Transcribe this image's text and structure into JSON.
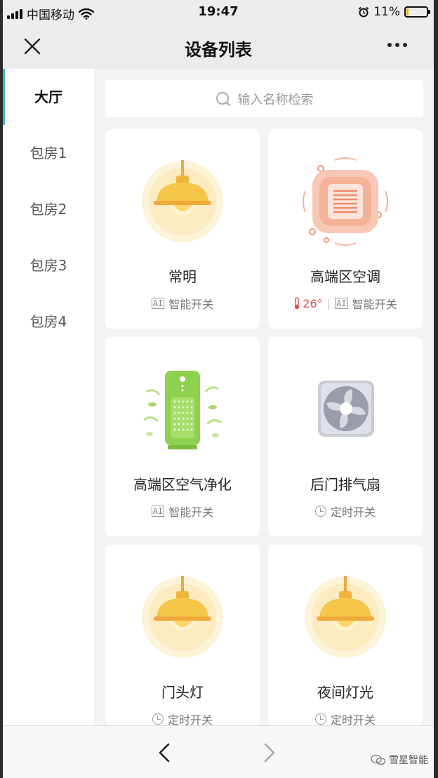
{
  "status_bar": {
    "carrier": "中国移动",
    "time": "19:47",
    "battery_percent": "11%",
    "battery_level": 0.11
  },
  "nav": {
    "title": "设备列表"
  },
  "sidebar": {
    "items": [
      {
        "label": "大厅",
        "active": true
      },
      {
        "label": "包房1",
        "active": false
      },
      {
        "label": "包房2",
        "active": false
      },
      {
        "label": "包房3",
        "active": false
      },
      {
        "label": "包房4",
        "active": false
      }
    ]
  },
  "search": {
    "placeholder": "输入名称检索"
  },
  "devices": [
    {
      "name": "常明",
      "icon": "lamp-icon",
      "ai_badge": "AI",
      "mode": "智能开关"
    },
    {
      "name": "高端区空调",
      "icon": "air-conditioner-icon",
      "temperature": "26°",
      "ai_badge": "AI",
      "mode": "智能开关"
    },
    {
      "name": "高端区空气净化",
      "icon": "air-purifier-icon",
      "ai_badge": "AI",
      "mode": "智能开关"
    },
    {
      "name": "后门排气扇",
      "icon": "exhaust-fan-icon",
      "mode": "定时开关"
    },
    {
      "name": "门头灯",
      "icon": "lamp-icon",
      "mode": "定时开关"
    },
    {
      "name": "夜间灯光",
      "icon": "lamp-icon",
      "mode": "定时开关"
    }
  ],
  "watermark": "雪星智能",
  "colors": {
    "accent": "#3fb8c9",
    "temperature": "#e0524f",
    "lamp": "#f5c542",
    "purifier": "#8ed14f",
    "heater": "#f4a58a"
  }
}
